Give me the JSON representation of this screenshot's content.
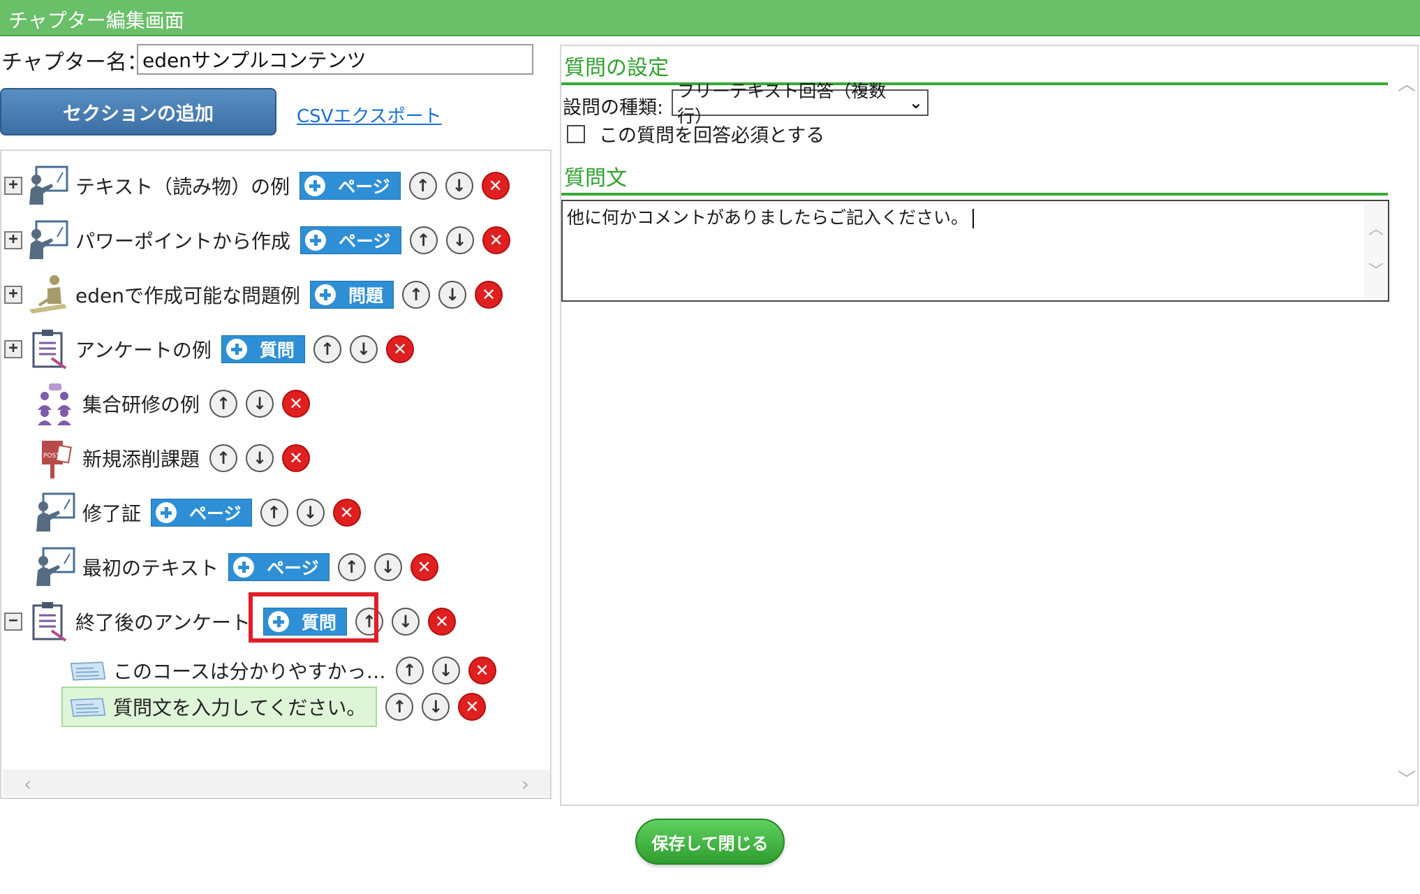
{
  "window": {
    "title": "チャプター編集画面"
  },
  "chapter": {
    "name_label": "チャプター名：",
    "name_value": "edenサンプルコンテンツ"
  },
  "toolbar": {
    "add_section_label": "セクションの追加",
    "csv_export_label": "CSVエクスポート"
  },
  "tree": {
    "expanders": {
      "collapsed": "+",
      "expanded": "−"
    },
    "buttons": {
      "up": "↑",
      "down": "↓",
      "delete": "✕"
    },
    "items": [
      {
        "label": "テキスト（読み物）の例",
        "icon": "presenter-icon",
        "add_label": "ページ",
        "expander": "collapsed"
      },
      {
        "label": "パワーポイントから作成",
        "icon": "presenter-icon",
        "add_label": "ページ",
        "expander": "collapsed"
      },
      {
        "label": "edenで作成可能な問題例",
        "icon": "writing-person-icon",
        "add_label": "問題",
        "expander": "collapsed"
      },
      {
        "label": "アンケートの例",
        "icon": "clipboard-icon",
        "add_label": "質問",
        "expander": "collapsed"
      },
      {
        "label": "集合研修の例",
        "icon": "group-training-icon"
      },
      {
        "label": "新規添削課題",
        "icon": "post-box-icon",
        "post_text": "POST"
      },
      {
        "label": "修了証",
        "icon": "presenter-icon",
        "add_label": "ページ"
      },
      {
        "label": "最初のテキスト",
        "icon": "presenter-icon",
        "add_label": "ページ"
      },
      {
        "label": "終了後のアンケート",
        "icon": "clipboard-icon",
        "add_label": "質問",
        "expander": "expanded"
      }
    ],
    "children": [
      {
        "label": "このコースは分かりやすかっ…",
        "icon": "question-card-icon"
      },
      {
        "label": "質問文を入力してください。",
        "icon": "question-card-icon",
        "selected": true
      }
    ],
    "scroll": {
      "left": "‹",
      "right": "›"
    }
  },
  "settings": {
    "header": "質問の設定",
    "type_label": "設問の種類:",
    "type_value": "フリーテキスト回答（複数行）",
    "required_label": "この質問を回答必須とする",
    "question_text_header": "質問文",
    "question_text_value": "他に何かコメントがありましたらご記入ください。",
    "scroll": {
      "up": "︿",
      "down": "﹀"
    }
  },
  "footer": {
    "save_close_label": "保存して閉じる"
  },
  "colors": {
    "titlebar": "#6abf69",
    "accent_green": "#2fa02f",
    "add_button_blue": "#2e8fd6",
    "delete_red": "#e02020",
    "highlight_red": "#e01e28"
  }
}
